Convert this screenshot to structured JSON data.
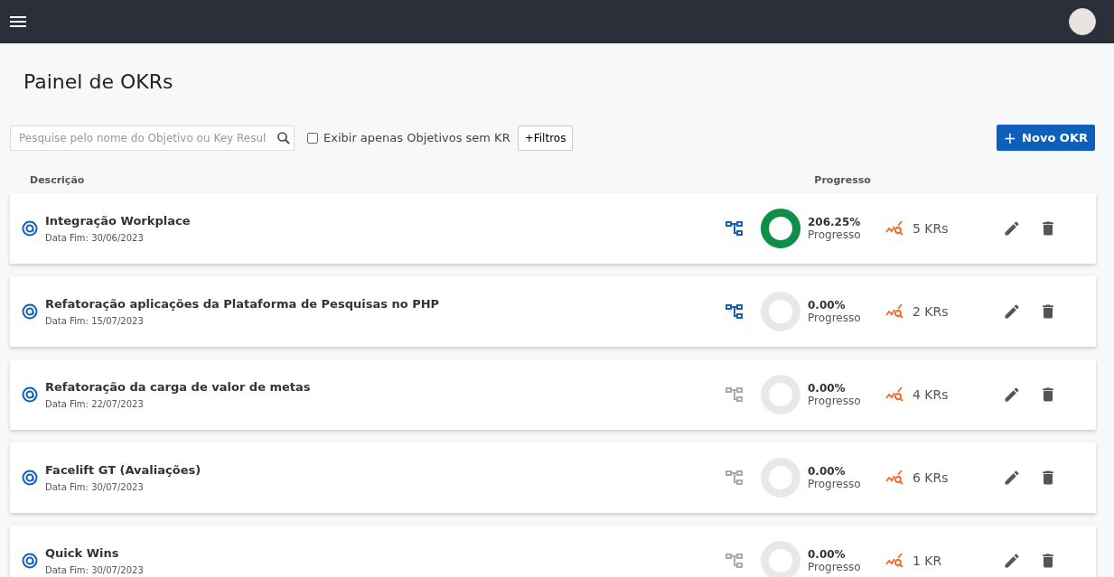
{
  "page_title": "Painel de OKRs",
  "search": {
    "placeholder": "Pesquise pelo nome do Objetivo ou Key Resul"
  },
  "filter_checkbox": {
    "label": "Exibir apenas Objetivos sem KR",
    "checked": false
  },
  "filters_button": "+Filtros",
  "new_button": {
    "icon": "+",
    "label": "Novo OKR"
  },
  "columns": {
    "description": "Descrição",
    "progress": "Progresso"
  },
  "okrs": [
    {
      "title": "Integração Workplace",
      "end_date": "Data Fim: 30/06/2023",
      "tree_active": true,
      "level": 1,
      "percent": "206.25%",
      "progress_label": "Progresso",
      "krs": "5 KRs"
    },
    {
      "title": "Refatoração aplicações da Plataforma de Pesquisas no PHP",
      "end_date": "Data Fim: 15/07/2023",
      "tree_active": true,
      "level": 0,
      "percent": "0.00%",
      "progress_label": "Progresso",
      "krs": "2 KRs"
    },
    {
      "title": "Refatoração da carga de valor de metas",
      "end_date": "Data Fim: 22/07/2023",
      "tree_active": false,
      "level": 0,
      "percent": "0.00%",
      "progress_label": "Progresso",
      "krs": "4 KRs"
    },
    {
      "title": "Facelift GT (Avaliações)",
      "end_date": "Data Fim: 30/07/2023",
      "tree_active": false,
      "level": 0,
      "percent": "0.00%",
      "progress_label": "Progresso",
      "krs": "6 KRs"
    },
    {
      "title": "Quick Wins",
      "end_date": "Data Fim: 30/07/2023",
      "tree_active": false,
      "level": 0,
      "percent": "0.00%",
      "progress_label": "Progresso",
      "krs": "1 KR"
    }
  ]
}
